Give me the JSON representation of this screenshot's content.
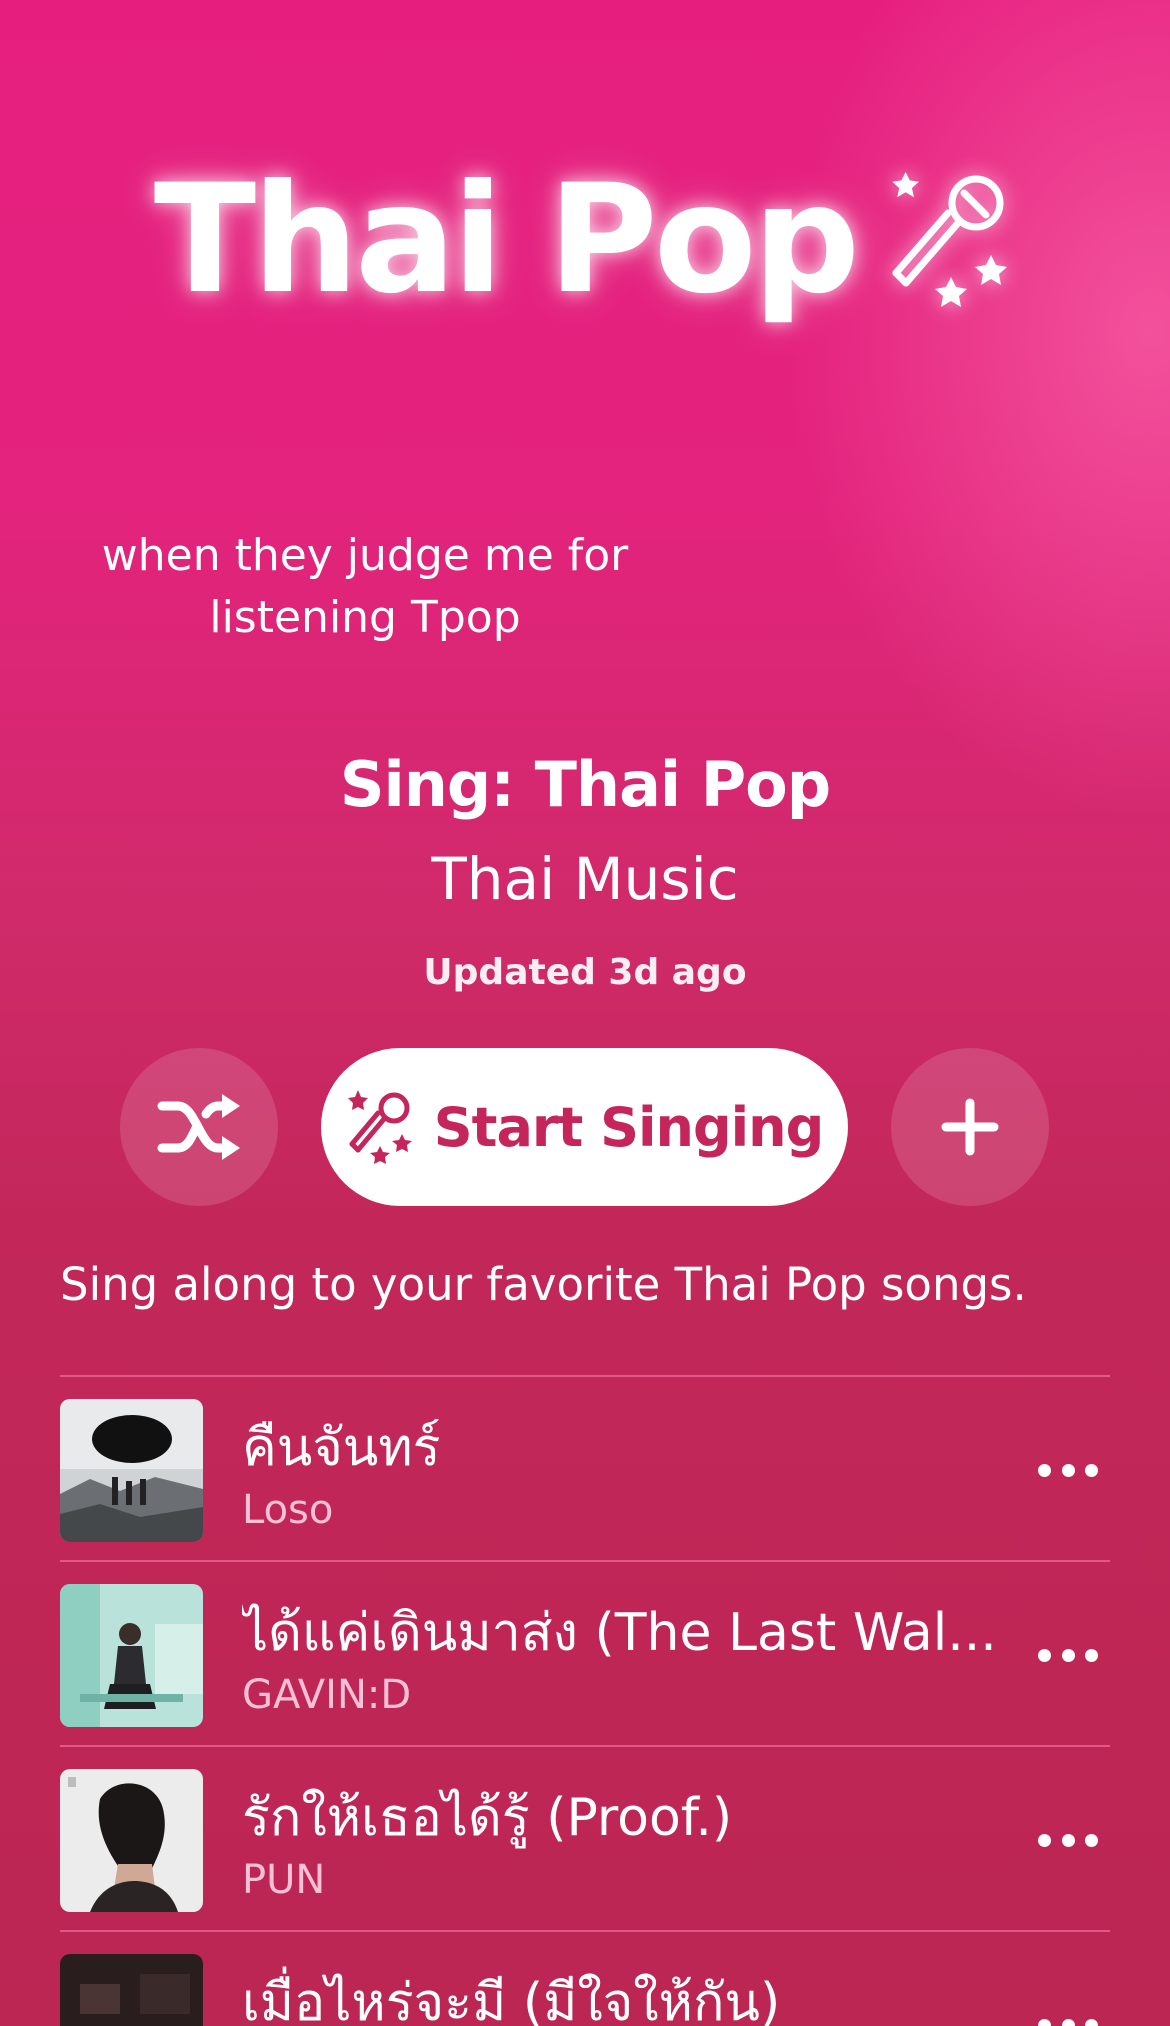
{
  "hero": {
    "title": "Thai Pop",
    "icon": "microphone-stars-icon"
  },
  "caption": {
    "line1": "when they judge me for",
    "line2": "listening Tpop"
  },
  "playlist": {
    "name": "Sing: Thai Pop",
    "curator": "Thai Music",
    "updated": "Updated 3d ago",
    "description": "Sing along to your favorite Thai Pop songs."
  },
  "actions": {
    "shuffle_icon": "shuffle-icon",
    "start_label": "Start Singing",
    "start_icon": "microphone-stars-icon",
    "add_icon": "plus-icon"
  },
  "tracks": [
    {
      "title": "คืนจันทร์",
      "artist": "Loso",
      "more_icon": "ellipsis-icon"
    },
    {
      "title": "ได้แค่เดินมาส่ง (The Last Wal...",
      "artist": "GAVIN:D",
      "more_icon": "ellipsis-icon"
    },
    {
      "title": "รักให้เธอได้รู้ (Proof.)",
      "artist": "PUN",
      "more_icon": "ellipsis-icon"
    },
    {
      "title": "เมื่อไหร่จะมี (มีใจให้กัน)",
      "artist": "",
      "more_icon": "ellipsis-icon"
    }
  ],
  "colors": {
    "accent": "#c4255a",
    "background_top": "#e61f7f",
    "background_bottom": "#bb2653"
  }
}
